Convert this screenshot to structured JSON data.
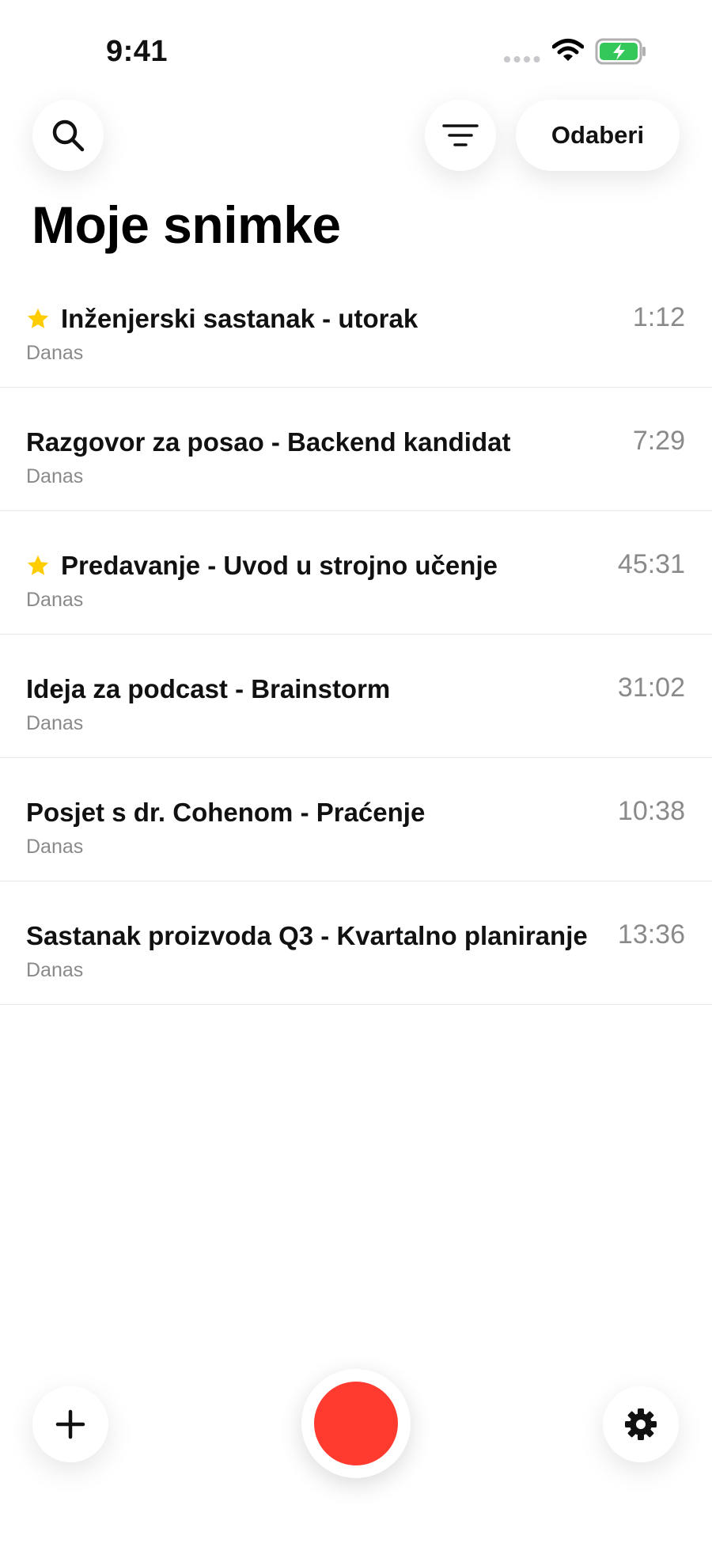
{
  "status_bar": {
    "time": "9:41",
    "icons": [
      "signal-dots-icon",
      "wifi-icon",
      "battery-charging-icon"
    ],
    "battery_color": "#34c759"
  },
  "toolbar": {
    "search_icon": "search-icon",
    "filter_icon": "sort-lines-icon",
    "select_label": "Odaberi"
  },
  "page": {
    "title": "Moje snimke"
  },
  "recordings": [
    {
      "title": "Inženjerski sastanak - utorak",
      "date": "Danas",
      "duration": "1:12",
      "starred": true
    },
    {
      "title": "Razgovor za posao - Backend kandidat",
      "date": "Danas",
      "duration": "7:29",
      "starred": false
    },
    {
      "title": "Predavanje - Uvod u strojno učenje",
      "date": "Danas",
      "duration": "45:31",
      "starred": true
    },
    {
      "title": "Ideja za podcast - Brainstorm",
      "date": "Danas",
      "duration": "31:02",
      "starred": false
    },
    {
      "title": "Posjet s dr. Cohenom - Praćenje",
      "date": "Danas",
      "duration": "10:38",
      "starred": false
    },
    {
      "title": "Sastanak proizvoda Q3 - Kvartalno planiranje",
      "date": "Danas",
      "duration": "13:36",
      "starred": false
    }
  ],
  "bottom_bar": {
    "add_icon": "plus-icon",
    "record_icon": "record-icon",
    "settings_icon": "gear-icon",
    "record_color": "#ff3b30"
  },
  "colors": {
    "star": "#ffcc00",
    "secondary_text": "#8a8a8a",
    "primary_text": "#111111"
  }
}
